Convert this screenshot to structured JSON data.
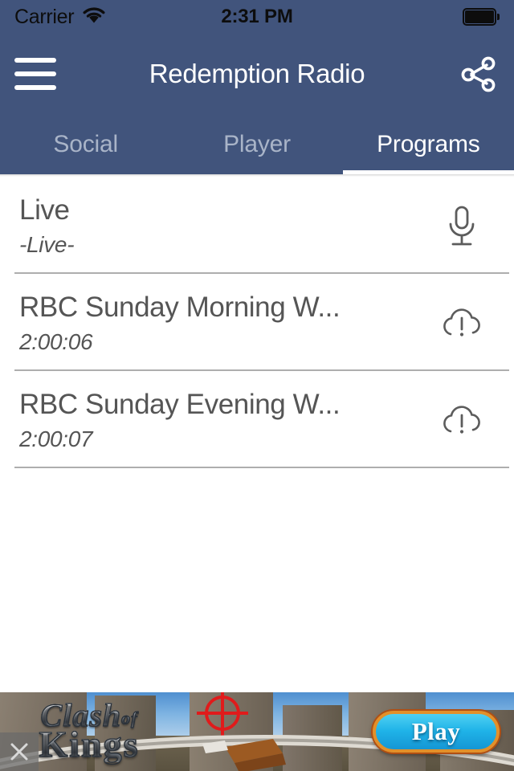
{
  "status_bar": {
    "carrier": "Carrier",
    "wifi_icon": "wifi-icon",
    "time": "2:31 PM",
    "battery_icon": "battery-full-icon"
  },
  "nav_bar": {
    "menu_icon": "hamburger-menu-icon",
    "title": "Redemption Radio",
    "share_icon": "share-icon"
  },
  "tabs": [
    {
      "label": "Social",
      "active": false
    },
    {
      "label": "Player",
      "active": false
    },
    {
      "label": "Programs",
      "active": true
    }
  ],
  "programs": [
    {
      "title": "Live",
      "duration": "-Live-",
      "icon": "microphone-icon"
    },
    {
      "title": "RBC Sunday Morning W...",
      "duration": "2:00:06",
      "icon": "cloud-alert-icon"
    },
    {
      "title": "RBC Sunday Evening W...",
      "duration": "2:00:07",
      "icon": "cloud-alert-icon"
    }
  ],
  "ad": {
    "logo_line1": "Clash",
    "logo_line1_suffix": "of",
    "logo_line2": "Kings",
    "play_label": "Play",
    "close_label": "×"
  },
  "colors": {
    "header_blue": "#41547c",
    "tab_inactive": "#a9b4c8",
    "tab_active": "#ffffff",
    "list_text": "#555555",
    "divider": "#aeaeae",
    "crosshair_red": "#e01b1b",
    "play_button_blue": "#1fb3e8",
    "play_button_border": "#e2902a"
  }
}
